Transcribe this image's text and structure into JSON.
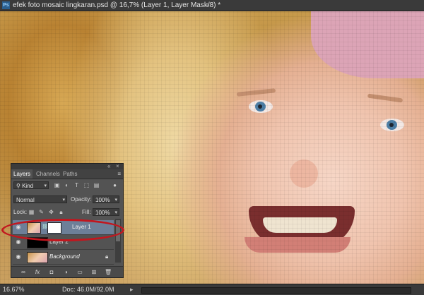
{
  "window": {
    "title": "efek foto mosaic lingkaran.psd @ 16,7% (Layer 1, Layer Mask/8) *",
    "app_icon": "Ps",
    "close_glyph": "×"
  },
  "status_bar": {
    "zoom": "16.67%",
    "doc_size": "Doc: 46.0M/92.0M"
  },
  "layers_panel": {
    "tabs": [
      "Layers",
      "Channels",
      "Paths"
    ],
    "active_tab": "Layers",
    "filter_kind": "Kind",
    "blend_mode": "Normal",
    "opacity_label": "Opacity:",
    "opacity_value": "100%",
    "lock_label": "Lock:",
    "fill_label": "Fill:",
    "fill_value": "100%",
    "layers": [
      {
        "name": "Layer 1",
        "selected": true,
        "has_mask": true
      },
      {
        "name": "Layer 2",
        "selected": false,
        "has_mask": false
      },
      {
        "name": "Background",
        "selected": false,
        "has_mask": false,
        "locked": true
      }
    ],
    "icons": {
      "panel_collapse": "collapse-icon",
      "panel_close": "close-icon",
      "panel_menu": "menu-icon",
      "kind_filter": "search-icon",
      "lock": "lock-icon",
      "visibility": "eye-icon",
      "link": "chain-link-icon"
    }
  },
  "annotation": {
    "highlight_color": "#c2161e"
  }
}
